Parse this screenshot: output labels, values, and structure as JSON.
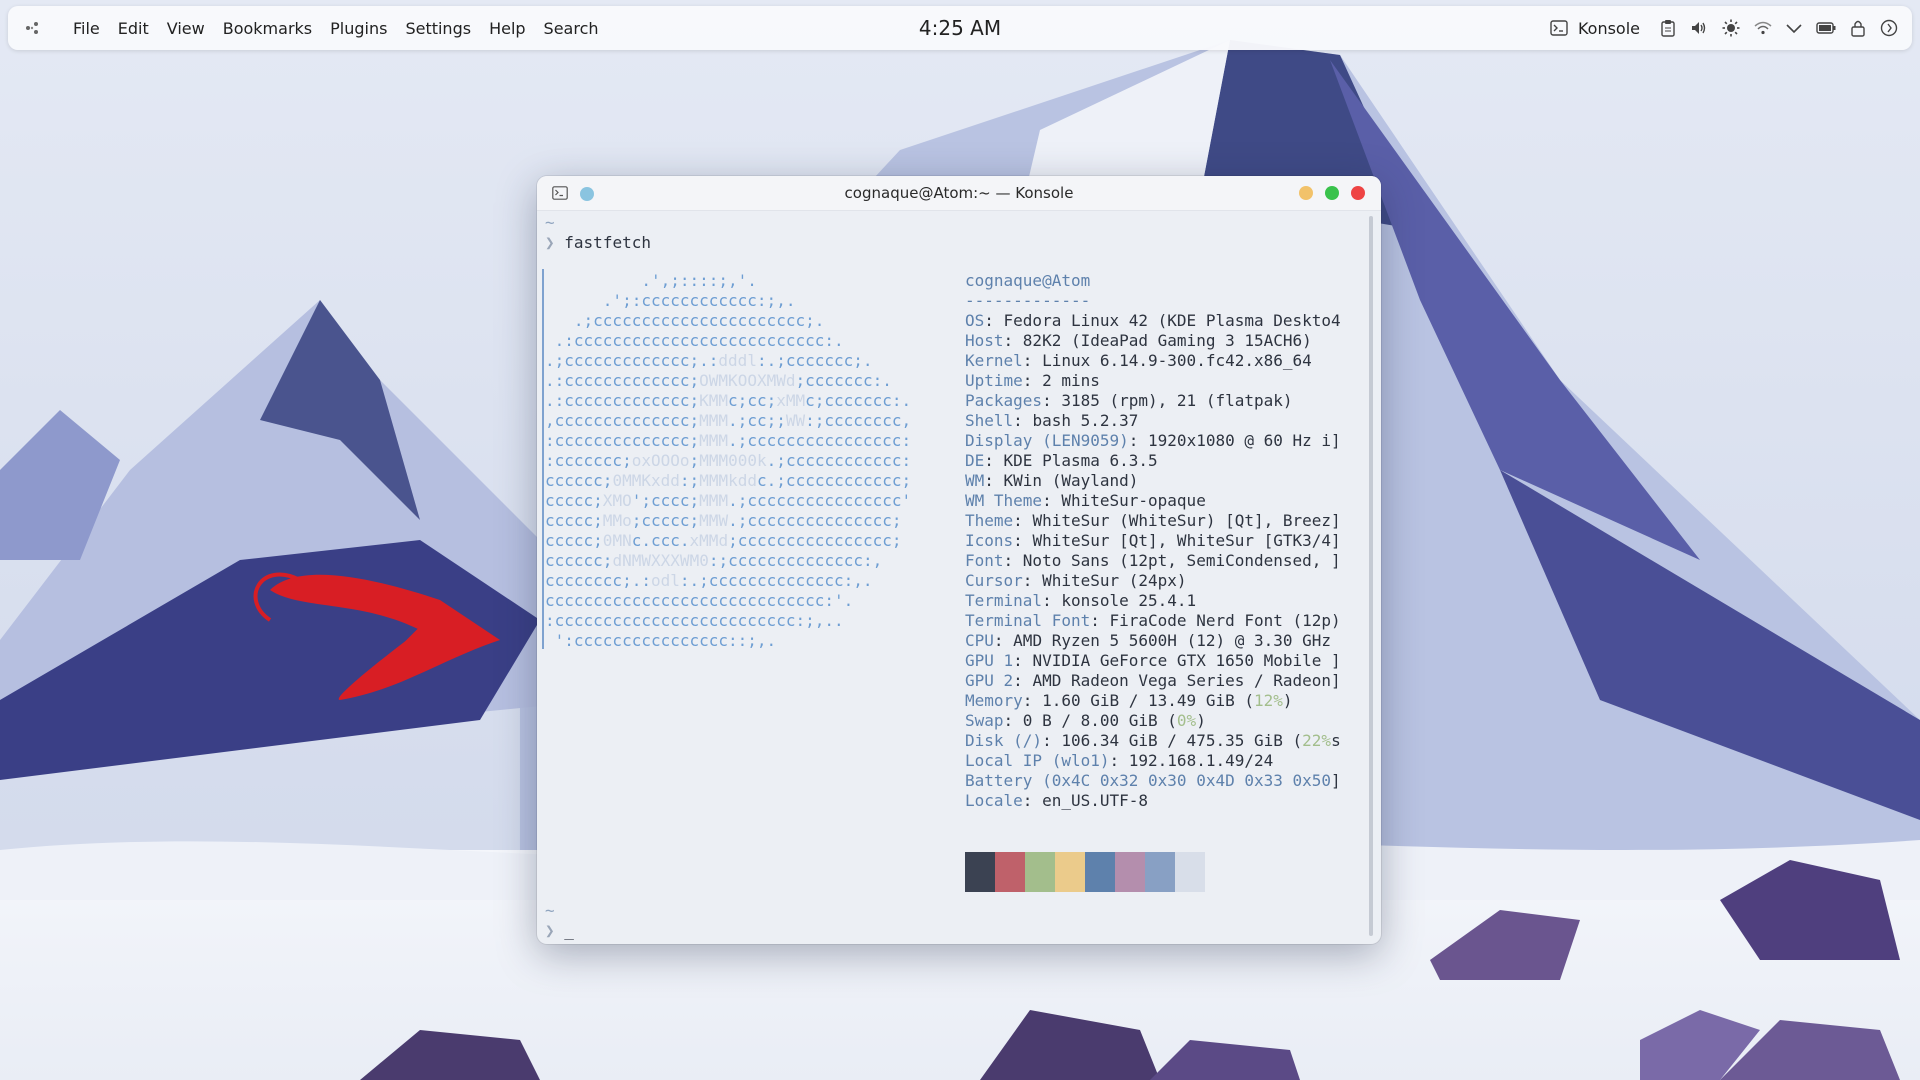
{
  "panel": {
    "menu": [
      "File",
      "Edit",
      "View",
      "Bookmarks",
      "Plugins",
      "Settings",
      "Help",
      "Search"
    ],
    "clock": "4:25 AM",
    "active_app": "Konsole",
    "tray_icons": [
      "clipboard-icon",
      "volume-icon",
      "brightness-icon",
      "wifi-icon",
      "chevron-down-icon",
      "battery-icon",
      "lock-icon",
      "power-icon"
    ]
  },
  "window": {
    "title": "cognaque@Atom:~ — Konsole"
  },
  "terminal": {
    "tilde": "~",
    "prompt": "❯",
    "command": "fastfetch",
    "cursor": "_",
    "logo_lines": [
      "          .',;::::;,'.",
      "      .';:cccccccccccc:;,.",
      "   .;cccccccccccccccccccccc;.",
      " .:cccccccccccccccccccccccccc:.",
      ".;ccccccccccccc;.:dddl:.;ccccccc;.",
      ".:ccccccccccccc;OWMKOOXMWd;ccccccc:.",
      ".:ccccccccccccc;KMMc;cc;xMMc;ccccccc:.",
      ",cccccccccccccc;MMM.;cc;;WW:;cccccccc,",
      ":cccccccccccccc;MMM.;cccccccccccccccc:",
      ":ccccccc;oxOOOo;MMM000k.;cccccccccccc:",
      "cccccc;0MMKxdd:;MMMkddc.;cccccccccccc;",
      "ccccc;XMO';cccc;MMM.;cccccccccccccccc'",
      "ccccc;MMo;ccccc;MMW.;ccccccccccccccc;",
      "ccccc;0MNc.ccc.xMMd;cccccccccccccccc;",
      "cccccc;dNMWXXXWM0:;cccccccccccccc:,",
      "cccccccc;.:odl:.;cccccccccccccc:,.",
      "ccccccccccccccccccccccccccccc:'.",
      ":ccccccccccccccccccccccccc:;,..",
      " ':cccccccccccccccc::;,."
    ],
    "info": [
      {
        "k": "cognaque",
        "v": "@Atom",
        "type": "header"
      },
      {
        "k": "-------------",
        "v": "",
        "type": "sep"
      },
      {
        "k": "OS",
        "v": "Fedora Linux 42 (KDE Plasma Deskto4"
      },
      {
        "k": "Host",
        "v": "82K2 (IdeaPad Gaming 3 15ACH6)"
      },
      {
        "k": "Kernel",
        "v": "Linux 6.14.9-300.fc42.x86_64"
      },
      {
        "k": "Uptime",
        "v": "2 mins"
      },
      {
        "k": "Packages",
        "v": "3185 (rpm), 21 (flatpak)"
      },
      {
        "k": "Shell",
        "v": "bash 5.2.37"
      },
      {
        "k": "Display (LEN9059)",
        "v": "1920x1080 @ 60 Hz i]"
      },
      {
        "k": "DE",
        "v": "KDE Plasma 6.3.5"
      },
      {
        "k": "WM",
        "v": "KWin (Wayland)"
      },
      {
        "k": "WM Theme",
        "v": "WhiteSur-opaque"
      },
      {
        "k": "Theme",
        "v": "WhiteSur (WhiteSur) [Qt], Breez]"
      },
      {
        "k": "Icons",
        "v": "WhiteSur [Qt], WhiteSur [GTK3/4]"
      },
      {
        "k": "Font",
        "v": "Noto Sans (12pt, SemiCondensed, ]"
      },
      {
        "k": "Cursor",
        "v": "WhiteSur (24px)"
      },
      {
        "k": "Terminal",
        "v": "konsole 25.4.1"
      },
      {
        "k": "Terminal Font",
        "v": "FiraCode Nerd Font (12p)"
      },
      {
        "k": "CPU",
        "v": "AMD Ryzen 5 5600H (12) @ 3.30 GHz"
      },
      {
        "k": "GPU 1",
        "v": "NVIDIA GeForce GTX 1650 Mobile ]"
      },
      {
        "k": "GPU 2",
        "v": "AMD Radeon Vega Series / Radeon]"
      },
      {
        "k": "Memory",
        "v": "1.60 GiB / 13.49 GiB (",
        "pct": "12%",
        "tail": ")"
      },
      {
        "k": "Swap",
        "v": "0 B / 8.00 GiB (",
        "pct": "0%",
        "tail": ")"
      },
      {
        "k": "Disk (/)",
        "v": "106.34 GiB / 475.35 GiB (",
        "pct": "22%",
        "tail": "s"
      },
      {
        "k": "Local IP (wlo1)",
        "v": "192.168.1.49/24"
      },
      {
        "k": "Battery (0x4C 0x32 0x30 0x4D 0x33 0x50",
        "v": "]",
        "keyonly": true
      },
      {
        "k": "Locale",
        "v": "en_US.UTF-8"
      }
    ],
    "palette": [
      "#3b4252",
      "#bf616a",
      "#a3be8c",
      "#ebcb8b",
      "#5e81ac",
      "#b48ead",
      "#88a0c4",
      "#d8dee9"
    ]
  }
}
